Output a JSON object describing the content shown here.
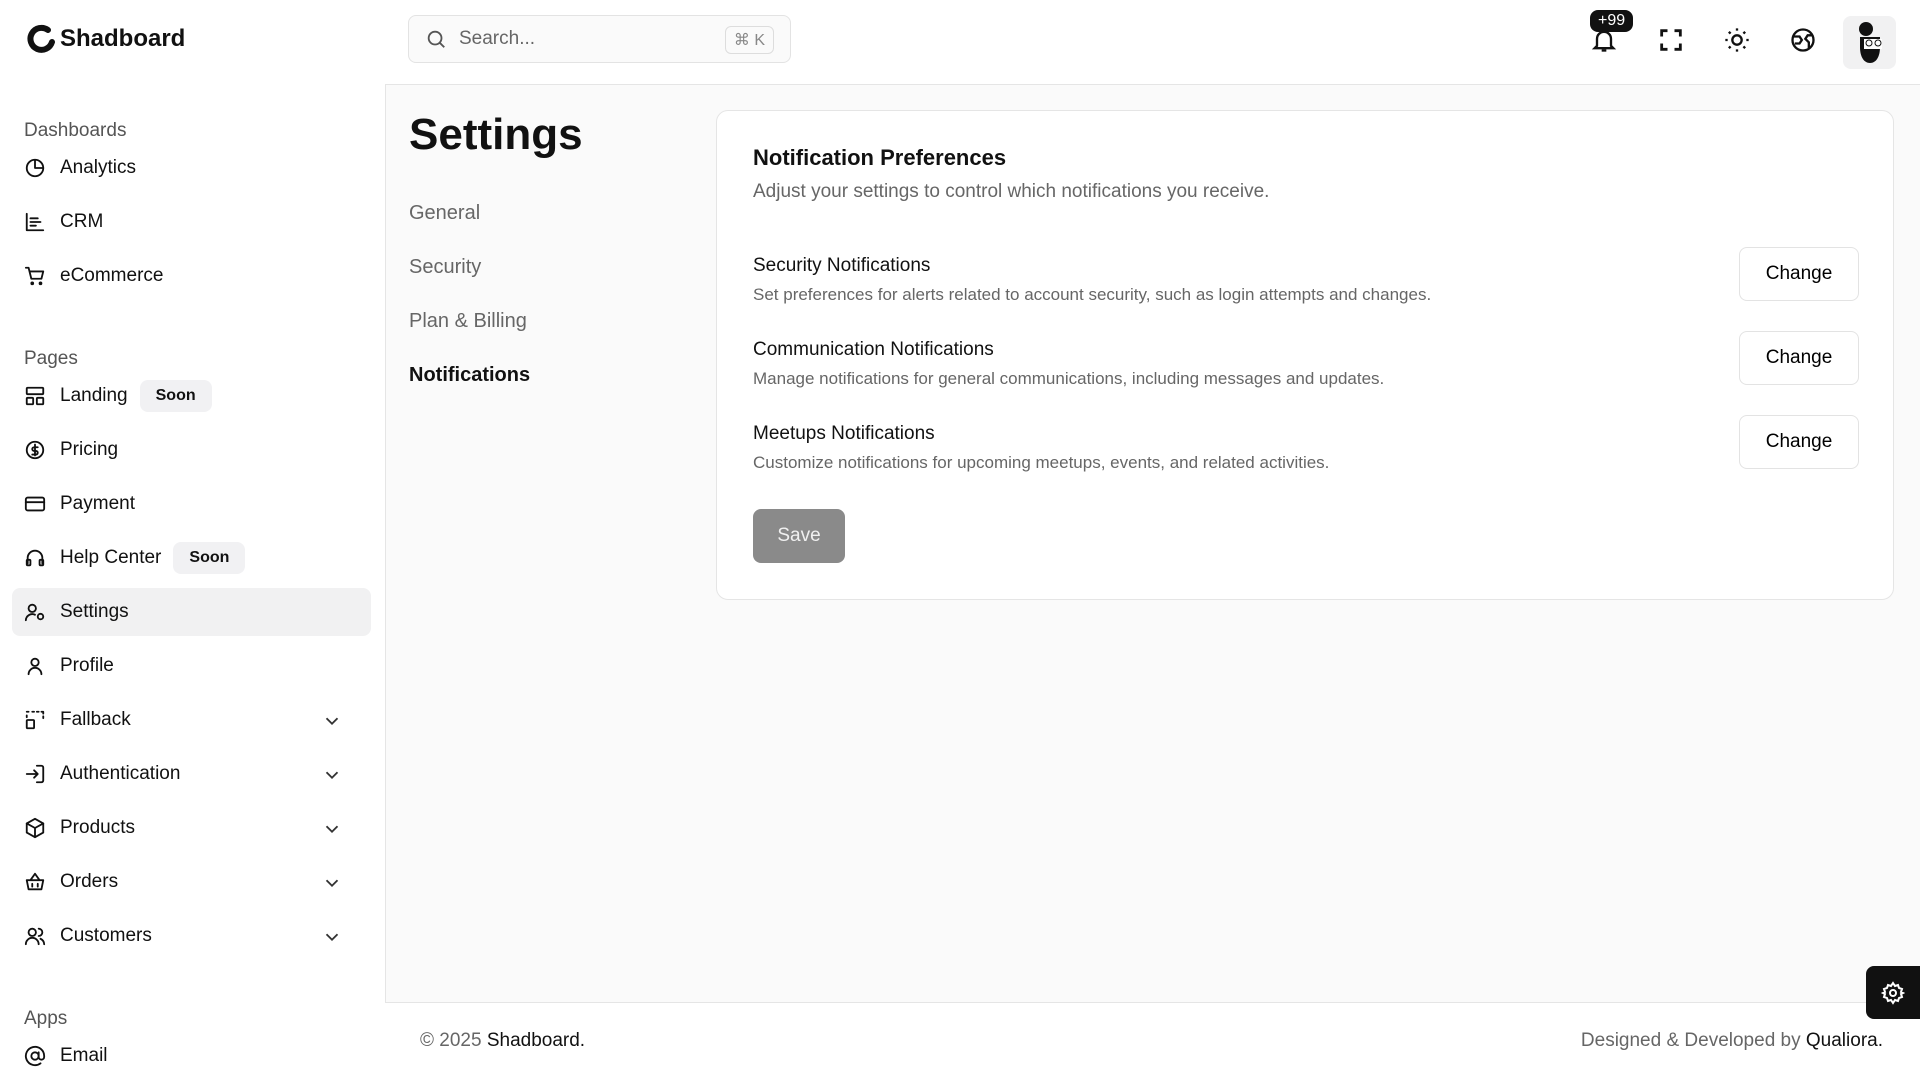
{
  "app": {
    "name": "Shadboard"
  },
  "search": {
    "placeholder": "Search...",
    "shortcut": "⌘ K"
  },
  "header": {
    "notification_badge": "+99",
    "icons": [
      "bell-icon",
      "fullscreen-icon",
      "theme-toggle-icon",
      "globe-icon",
      "avatar"
    ]
  },
  "sidebar": {
    "groups": [
      {
        "label": "Dashboards",
        "items": [
          {
            "label": "Analytics",
            "icon": "pie-chart-icon"
          },
          {
            "label": "CRM",
            "icon": "bar-chart-icon"
          },
          {
            "label": "eCommerce",
            "icon": "cart-icon"
          }
        ]
      },
      {
        "label": "Pages",
        "items": [
          {
            "label": "Landing",
            "icon": "layout-icon",
            "badge": "Soon"
          },
          {
            "label": "Pricing",
            "icon": "dollar-circle-icon"
          },
          {
            "label": "Payment",
            "icon": "credit-card-icon"
          },
          {
            "label": "Help Center",
            "icon": "headphones-icon",
            "badge": "Soon"
          },
          {
            "label": "Settings",
            "icon": "user-cog-icon",
            "active": true
          },
          {
            "label": "Profile",
            "icon": "user-icon"
          },
          {
            "label": "Fallback",
            "icon": "fallback-icon",
            "expandable": true
          },
          {
            "label": "Authentication",
            "icon": "login-icon",
            "expandable": true
          },
          {
            "label": "Products",
            "icon": "package-icon",
            "expandable": true
          },
          {
            "label": "Orders",
            "icon": "basket-icon",
            "expandable": true
          },
          {
            "label": "Customers",
            "icon": "users-icon",
            "expandable": true
          }
        ]
      },
      {
        "label": "Apps",
        "items": [
          {
            "label": "Email",
            "icon": "at-icon"
          }
        ]
      }
    ]
  },
  "page": {
    "title": "Settings",
    "nav": [
      "General",
      "Security",
      "Plan & Billing",
      "Notifications"
    ],
    "active_nav": "Notifications"
  },
  "card": {
    "title": "Notification Preferences",
    "subtitle": "Adjust your settings to control which notifications you receive.",
    "rows": [
      {
        "title": "Security Notifications",
        "desc": "Set preferences for alerts related to account security, such as login attempts and changes.",
        "button": "Change"
      },
      {
        "title": "Communication Notifications",
        "desc": "Manage notifications for general communications, including messages and updates.",
        "button": "Change"
      },
      {
        "title": "Meetups Notifications",
        "desc": "Customize notifications for upcoming meetups, events, and related activities.",
        "button": "Change"
      }
    ],
    "save": "Save"
  },
  "footer": {
    "copyright_prefix": "© 2025",
    "brand": "Shadboard.",
    "credit_prefix": "Designed & Developed by",
    "credit_name": "Qualiora."
  }
}
